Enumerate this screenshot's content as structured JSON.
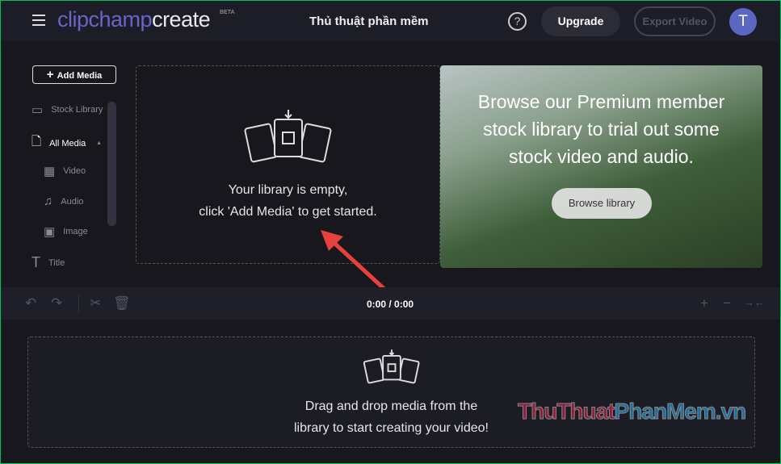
{
  "header": {
    "logo_a": "clipchamp",
    "logo_b": "create",
    "beta": "BETA",
    "project_title": "Thủ thuật phần mềm",
    "help": "?",
    "upgrade": "Upgrade",
    "export": "Export Video",
    "avatar": "T"
  },
  "sidebar": {
    "add_media": "Add Media",
    "items": [
      {
        "label": "Stock Library"
      },
      {
        "label": "All Media"
      },
      {
        "label": "Video"
      },
      {
        "label": "Audio"
      },
      {
        "label": "Image"
      },
      {
        "label": "Title"
      }
    ]
  },
  "library": {
    "empty_line1": "Your library is empty,",
    "empty_line2": "click 'Add Media' to get started."
  },
  "promo": {
    "text": "Browse our Premium member stock library to trial out some stock video and audio.",
    "button": "Browse library"
  },
  "timeline": {
    "time": "0:00 / 0:00",
    "drop_line1": "Drag and drop media from the",
    "drop_line2": "library to start creating your video!"
  },
  "watermark": {
    "part1": "ThuThuat",
    "part2": "PhanMem",
    "part3": ".vn"
  },
  "colors": {
    "accent": "#6b63c7",
    "avatar": "#5c67c4",
    "arrow": "#e8413c"
  }
}
